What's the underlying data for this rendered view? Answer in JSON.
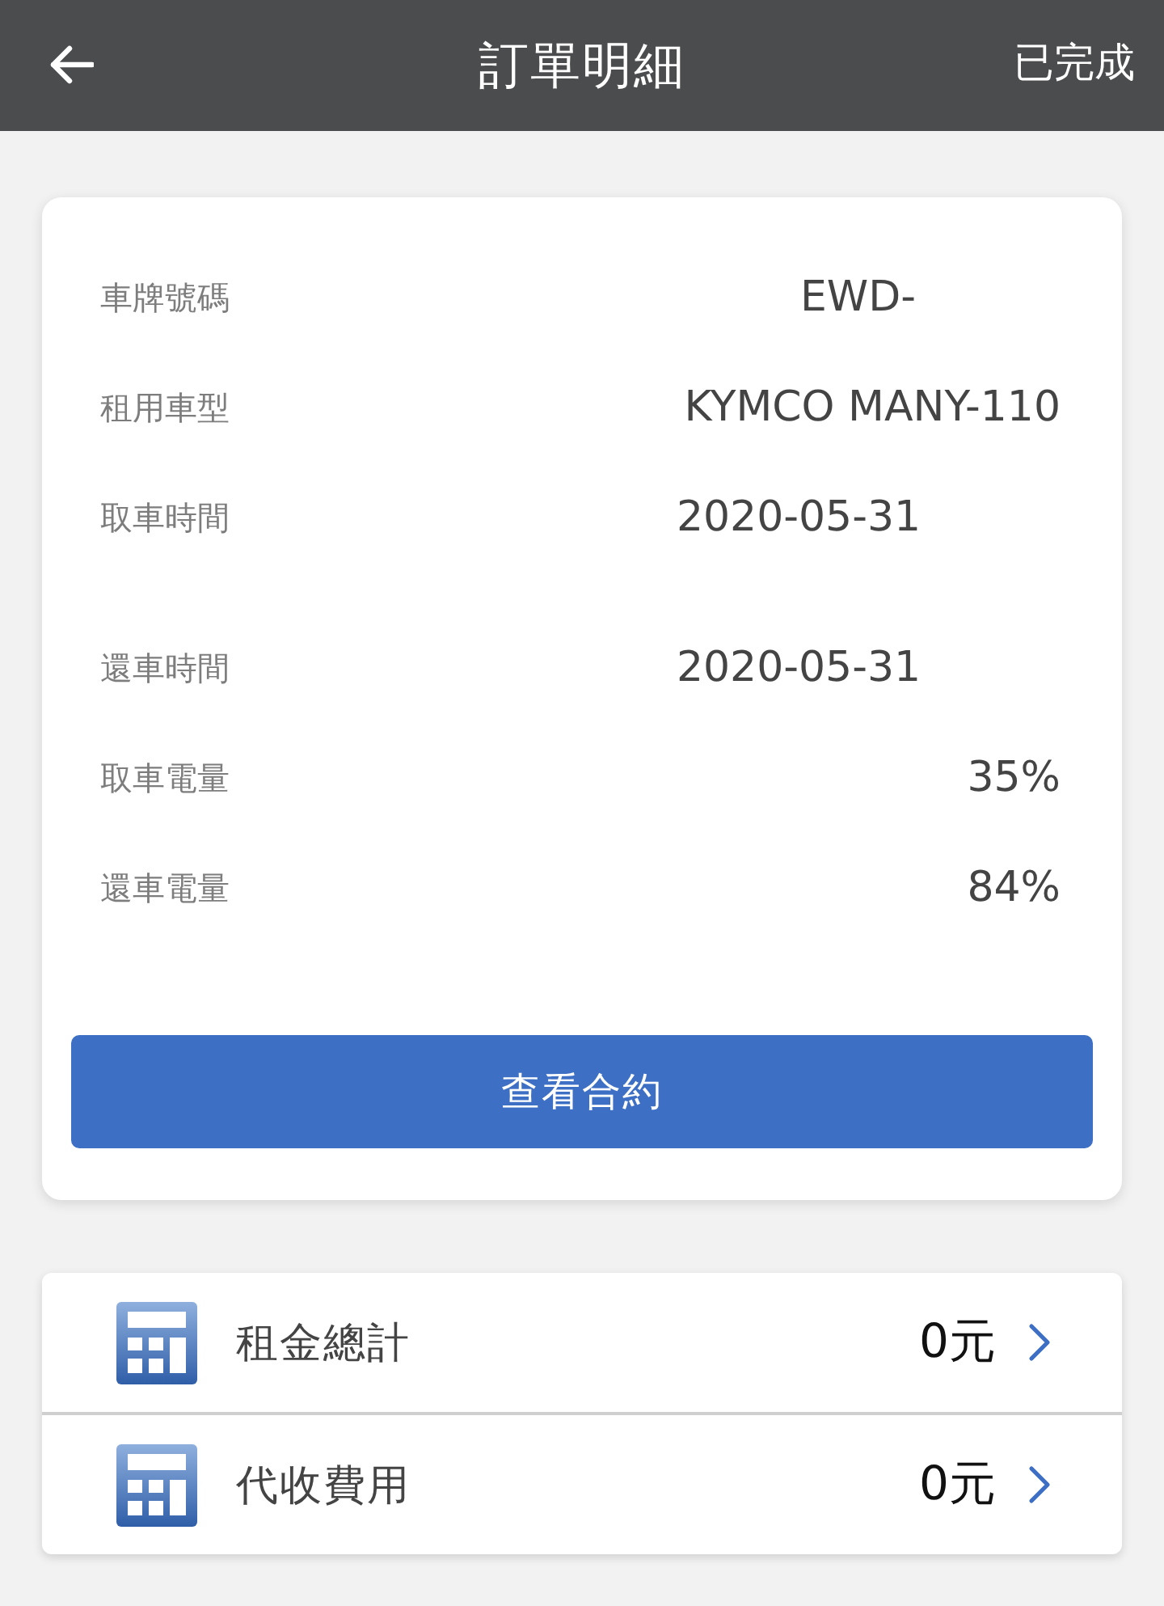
{
  "header": {
    "title": "訂單明細",
    "status": "已完成"
  },
  "details": {
    "rows": [
      {
        "label": "車牌號碼",
        "value": "EWD-",
        "kind": "plate"
      },
      {
        "label": "租用車型",
        "value": "KYMCO MANY-110",
        "kind": "text"
      },
      {
        "label": "取車時間",
        "value": "2020-05-31",
        "kind": "date"
      },
      {
        "label": "還車時間",
        "value": "2020-05-31",
        "kind": "date"
      },
      {
        "label": "取車電量",
        "value": "35%",
        "kind": "text"
      },
      {
        "label": "還車電量",
        "value": "84%",
        "kind": "text"
      }
    ],
    "button": "查看合約"
  },
  "fees": [
    {
      "label": "租金總計",
      "amount": "0元"
    },
    {
      "label": "代收費用",
      "amount": "0元"
    }
  ]
}
